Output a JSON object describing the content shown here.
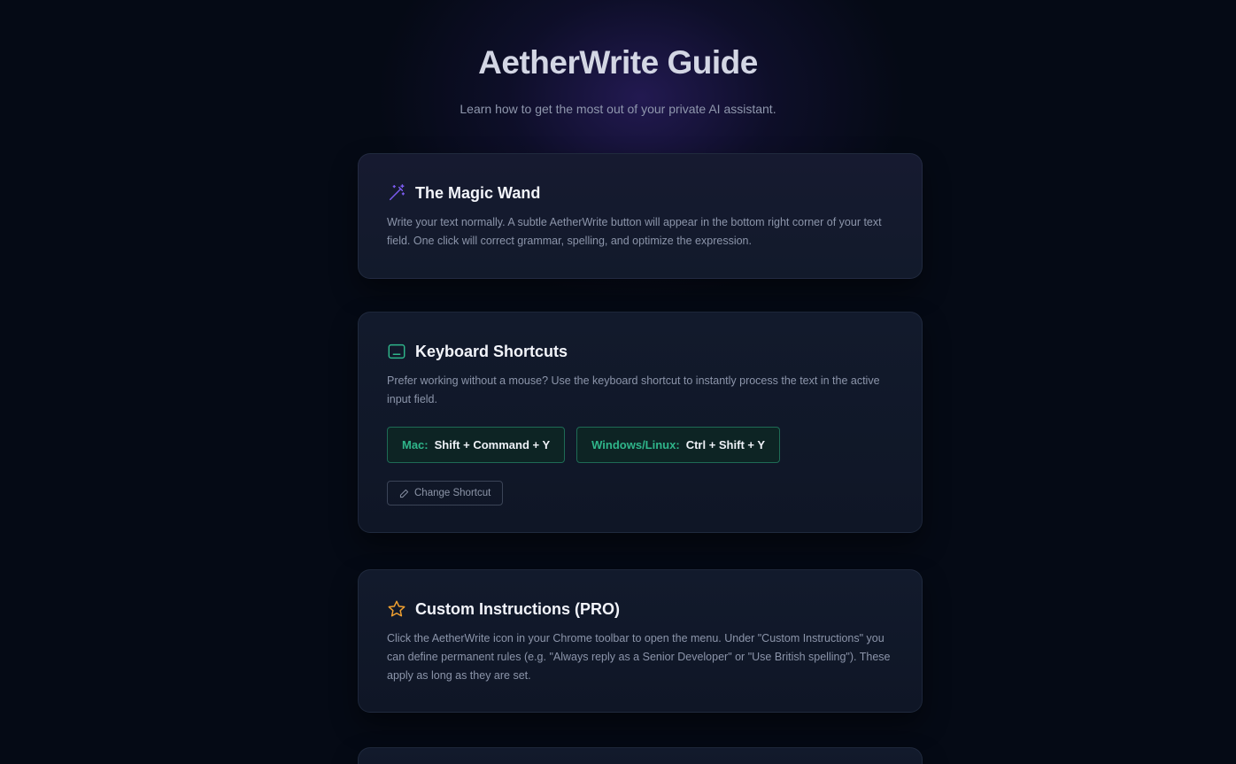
{
  "header": {
    "title": "AetherWrite Guide",
    "subtitle": "Learn how to get the most out of your private AI assistant."
  },
  "sections": [
    {
      "icon": "magic-wand-icon",
      "title": "The Magic Wand",
      "text": "Write your text normally. A subtle AetherWrite button will appear in the bottom right corner of your text field. One click will correct grammar, spelling, and optimize the expression."
    },
    {
      "icon": "keyboard-icon",
      "title": "Keyboard Shortcuts",
      "text": "Prefer working without a mouse? Use the keyboard shortcut to instantly process the text in the active input field.",
      "shortcuts": [
        {
          "os": "Mac:",
          "keys": "Shift + Command + Y"
        },
        {
          "os": "Windows/Linux:",
          "keys": "Ctrl + Shift + Y"
        }
      ],
      "change_label": "Change Shortcut"
    },
    {
      "icon": "star-icon",
      "title": "Custom Instructions (PRO)",
      "text": "Click the AetherWrite icon in your Chrome toolbar to open the menu. Under \"Custom Instructions\" you can define permanent rules (e.g. \"Always reply as a Senior Developer\" or \"Use British spelling\"). These apply as long as they are set."
    }
  ],
  "colors": {
    "background": "#050a15",
    "accent_purple": "#7b5cf0",
    "accent_green": "#2fb58a",
    "accent_orange": "#f0a030"
  }
}
